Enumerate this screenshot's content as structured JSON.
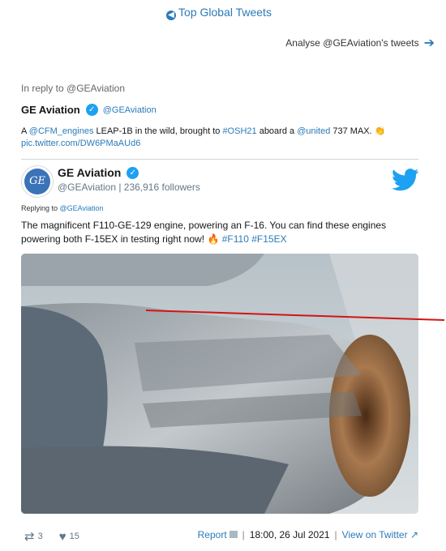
{
  "nav": {
    "top_link": "Top Global Tweets",
    "analyse": "Analyse @GEAviation's tweets"
  },
  "parent": {
    "in_reply_to": "In reply to @GEAviation",
    "name": "GE Aviation",
    "handle": "@GEAviation",
    "text_parts": [
      "A ",
      "@CFM_engines",
      " LEAP-1B in the wild, brought to ",
      "#OSH21",
      " aboard a ",
      "@united",
      " 737 MAX. 👏"
    ],
    "link": "pic.twitter.com/DW6PMaAUd6"
  },
  "tweet": {
    "name": "GE Aviation",
    "avatar_text": "GE",
    "handle_followers": "@GEAviation | 236,916 followers",
    "replying_label": "Replying to ",
    "replying_handle": "@GEAviation",
    "text": "The magnificent F110-GE-129 engine, powering an F-16. You can find these engines powering both F-15EX in testing right now! 🔥 ",
    "hashtag1": "#F110",
    "hashtag2": "#F15EX"
  },
  "actions": {
    "retweets": "3",
    "likes": "15",
    "report": "Report",
    "timestamp": "18:00, 26 Jul 2021",
    "view_on_twitter": "View on Twitter"
  },
  "colors": {
    "link": "#2b7bb9",
    "verified": "#1da1f2",
    "annotation": "#d21414"
  },
  "icons": {
    "top_link": "circle-left-arrow-icon",
    "analyse": "right-arrow-icon",
    "verified": "verified-check-icon",
    "brand": "twitter-bird-icon",
    "retweet": "retweet-icon",
    "like": "heart-icon",
    "report": "flag-icon",
    "external": "external-link-icon"
  }
}
